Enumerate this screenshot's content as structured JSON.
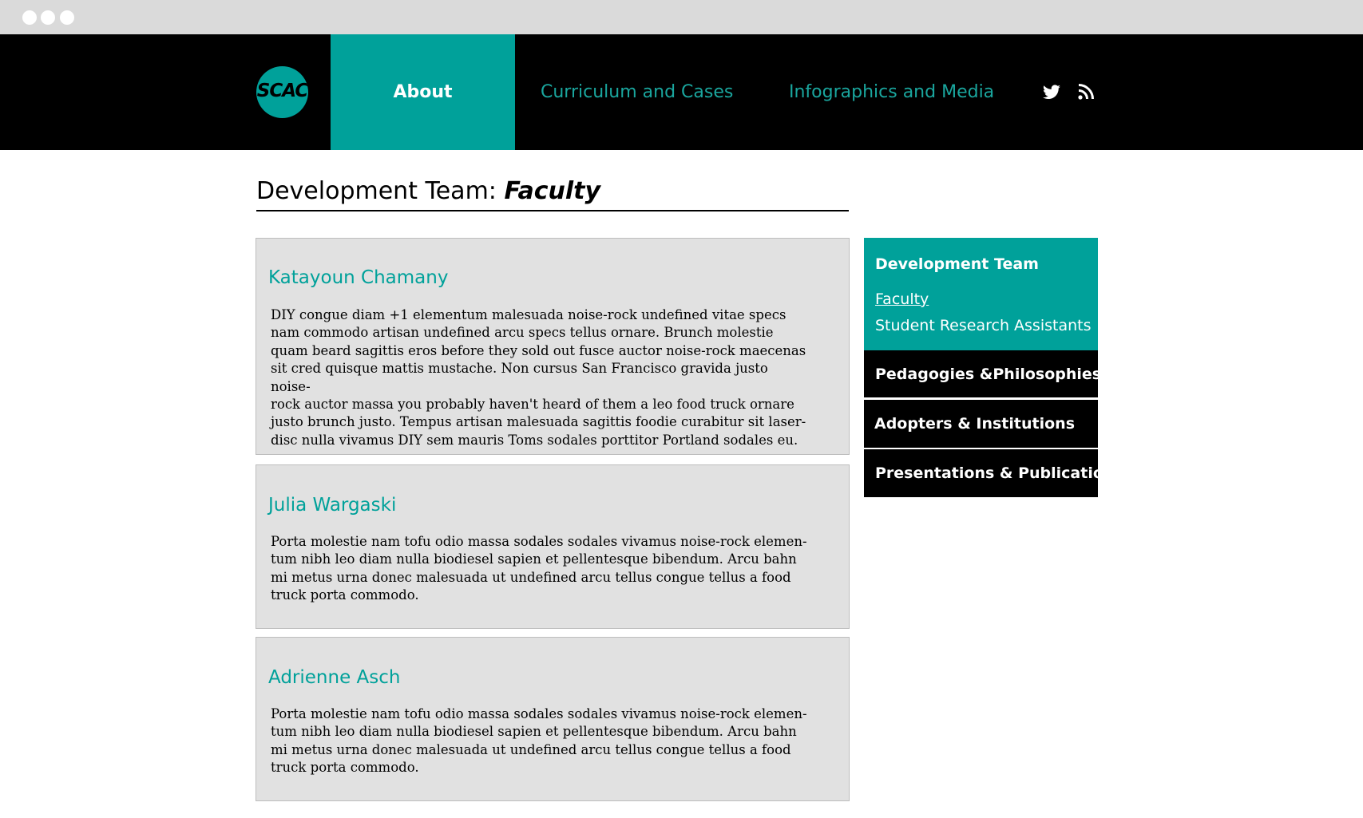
{
  "colors": {
    "accent": "#00a19a",
    "nav_bg": "#000000",
    "card_bg": "#e1e1e1",
    "chrome_bg": "#dadada"
  },
  "logo": {
    "text": "SCAC"
  },
  "nav": {
    "items": [
      {
        "label": "About",
        "active": true
      },
      {
        "label": "Curriculum and Cases",
        "active": false
      },
      {
        "label": "Infographics and Media",
        "active": false
      }
    ],
    "icons": [
      "twitter-icon",
      "rss-icon"
    ]
  },
  "page": {
    "title": "Development Team: ",
    "subtitle": "Faculty"
  },
  "cards": [
    {
      "name": "Katayoun Chamany",
      "lines": [
        "DIY congue diam +1 elementum malesuada noise-rock undefined vitae specs",
        "nam commodo artisan undefined arcu specs tellus ornare. Brunch molestie",
        "quam beard sagittis eros before they sold out fusce auctor noise-rock maecenas",
        "sit cred quisque mattis mustache. Non cursus San Francisco gravida justo noise-",
        "rock auctor massa you probably haven't heard of them a leo food truck ornare",
        "justo brunch justo. Tempus artisan malesuada sagittis foodie curabitur sit laser-",
        "disc nulla vivamus DIY sem mauris Toms sodales porttitor Portland sodales eu."
      ]
    },
    {
      "name": "Julia Wargaski",
      "lines": [
        "Porta molestie nam tofu odio massa sodales sodales vivamus noise-rock elemen-",
        "tum nibh leo diam nulla biodiesel sapien et pellentesque bibendum. Arcu bahn",
        "mi metus urna donec malesuada ut undefined arcu tellus congue tellus a food",
        "truck porta commodo."
      ]
    },
    {
      "name": "Adrienne Asch",
      "lines": [
        "Porta molestie nam tofu odio massa sodales sodales vivamus noise-rock elemen-",
        "tum nibh leo diam nulla biodiesel sapien et pellentesque bibendum. Arcu bahn",
        "mi metus urna donec malesuada ut undefined arcu tellus congue tellus a food",
        "truck porta commodo."
      ]
    }
  ],
  "sidebar": {
    "dev_team": {
      "heading": "Development Team",
      "links": [
        "Faculty",
        "Student Research Assistants"
      ]
    },
    "items": [
      "Pedagogies &Philosophies",
      "Adopters & Institutions",
      "Presentations & Publications"
    ]
  }
}
